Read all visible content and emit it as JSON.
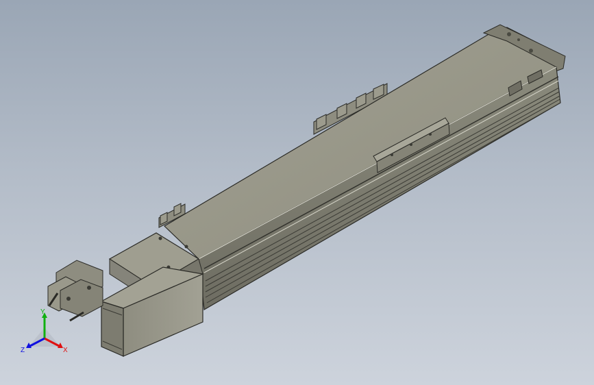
{
  "viewport": {
    "background_top": "#9aa6b5",
    "background_bottom": "#cdd3dc",
    "model_face_color": "#8f8e80",
    "model_top_color": "#9b9a8c",
    "model_edge_color": "#2a2a26"
  },
  "triad": {
    "x_label": "X",
    "y_label": "Y",
    "z_label": "Z",
    "x_color": "#e01010",
    "y_color": "#10b010",
    "z_color": "#1010e0"
  }
}
